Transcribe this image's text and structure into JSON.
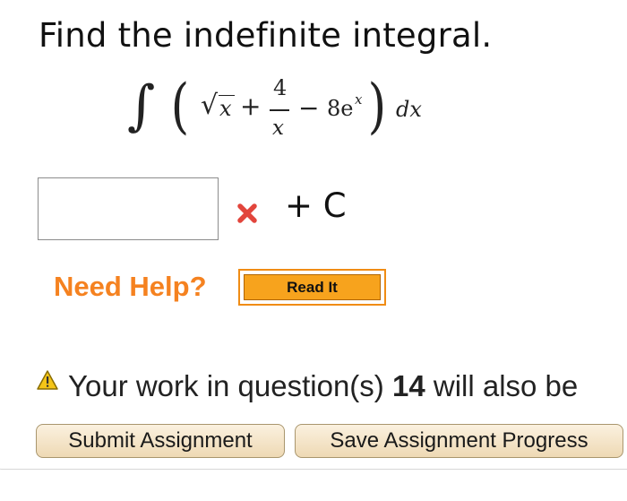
{
  "question": {
    "prompt": "Find the indefinite integral.",
    "integrand": {
      "integral_sign": "∫",
      "open_paren": "(",
      "sqrt_sign": "√",
      "sqrt_var": "x",
      "plus": "+",
      "frac_num": "4",
      "frac_den": "x",
      "minus": "−",
      "coef": "8e",
      "exp": "x",
      "close_paren": ")",
      "differential": "dx"
    },
    "answer_value": "",
    "plus_c": "+ C"
  },
  "help": {
    "label": "Need Help?",
    "read_it_label": "Read It"
  },
  "notice": {
    "prefix": "Your work in question(s)",
    "question_number": "14",
    "suffix": "will also be"
  },
  "buttons": {
    "submit_label": "Submit Assignment",
    "save_label": "Save Assignment Progress"
  },
  "colors": {
    "help_orange": "#f58220",
    "read_it_fill": "#f7a31d",
    "incorrect_red": "#e2453c",
    "warning_yellow": "#f5c518",
    "button_fill": "#f3e2c2"
  },
  "icons": {
    "status": "incorrect-x-icon",
    "notice": "warning-triangle-icon"
  }
}
